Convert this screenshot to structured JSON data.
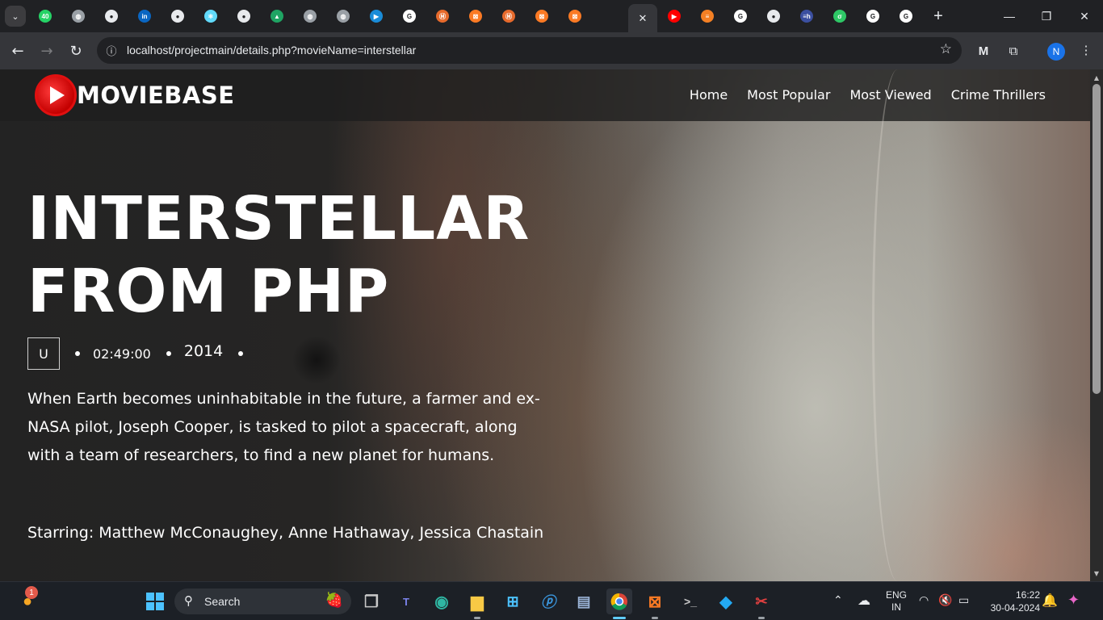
{
  "browser": {
    "tabs": [
      {
        "icon": "whatsapp-icon",
        "color": "#25d366",
        "glyph": "40"
      },
      {
        "icon": "globe-icon",
        "color": "#9aa0a6",
        "glyph": "◍"
      },
      {
        "icon": "github-icon",
        "color": "#e8eaed",
        "glyph": "●"
      },
      {
        "icon": "linkedin-icon",
        "color": "#0a66c2",
        "glyph": "in"
      },
      {
        "icon": "github-icon",
        "color": "#e8eaed",
        "glyph": "●"
      },
      {
        "icon": "react-icon",
        "color": "#61dafb",
        "glyph": "⚛"
      },
      {
        "icon": "github-icon",
        "color": "#e8eaed",
        "glyph": "●"
      },
      {
        "icon": "google-drive-icon",
        "color": "#1fa463",
        "glyph": "▲"
      },
      {
        "icon": "globe-icon",
        "color": "#9aa0a6",
        "glyph": "◍"
      },
      {
        "icon": "globe-icon",
        "color": "#9aa0a6",
        "glyph": "◍"
      },
      {
        "icon": "play-icon",
        "color": "#1a8cd8",
        "glyph": "▶"
      },
      {
        "icon": "google-icon",
        "color": "#ffffff",
        "glyph": "G"
      },
      {
        "icon": "mit-icon",
        "color": "#e66a2c",
        "glyph": "Ⓜ"
      },
      {
        "icon": "xampp-icon",
        "color": "#fb7a24",
        "glyph": "⊠"
      },
      {
        "icon": "mit-icon",
        "color": "#e66a2c",
        "glyph": "Ⓜ"
      },
      {
        "icon": "xampp-icon",
        "color": "#fb7a24",
        "glyph": "⊠"
      },
      {
        "icon": "xampp-icon",
        "color": "#fb7a24",
        "glyph": "⊠"
      }
    ],
    "tabs_after": [
      {
        "icon": "youtube-icon",
        "color": "#ff0000",
        "glyph": "▶"
      },
      {
        "icon": "stackoverflow-icon",
        "color": "#f48024",
        "glyph": "≡"
      },
      {
        "icon": "google-icon",
        "color": "#ffffff",
        "glyph": "G"
      },
      {
        "icon": "github-icon",
        "color": "#e8eaed",
        "glyph": "●"
      },
      {
        "icon": "hackerrank-icon",
        "color": "#3b4fa0",
        "glyph": "≡h"
      },
      {
        "icon": "leetcode-icon",
        "color": "#2ec866",
        "glyph": "σ"
      },
      {
        "icon": "google-icon",
        "color": "#ffffff",
        "glyph": "G"
      },
      {
        "icon": "google-icon",
        "color": "#ffffff",
        "glyph": "G"
      }
    ],
    "url": "localhost/projectmain/details.php?movieName=interstellar",
    "profile_initial": "N"
  },
  "site": {
    "brand": "MOVIEBASE",
    "nav": [
      "Home",
      "Most Popular",
      "Most Viewed",
      "Crime Thrillers"
    ],
    "movie": {
      "title": "INTERSTELLAR FROM PHP",
      "rating": "U",
      "duration": "02:49:00",
      "year": "2014",
      "description": "When Earth becomes uninhabitable in the future, a farmer and ex-NASA pilot, Joseph Cooper, is tasked to pilot a spacecraft, along with a team of researchers, to find a new planet for humans.",
      "starring": "Starring: Matthew McConaughey, Anne Hathaway, Jessica Chastain"
    }
  },
  "taskbar": {
    "search_label": "Search",
    "notification_count": "1",
    "language_line1": "ENG",
    "language_line2": "IN",
    "time": "16:22",
    "date": "30-04-2024"
  }
}
